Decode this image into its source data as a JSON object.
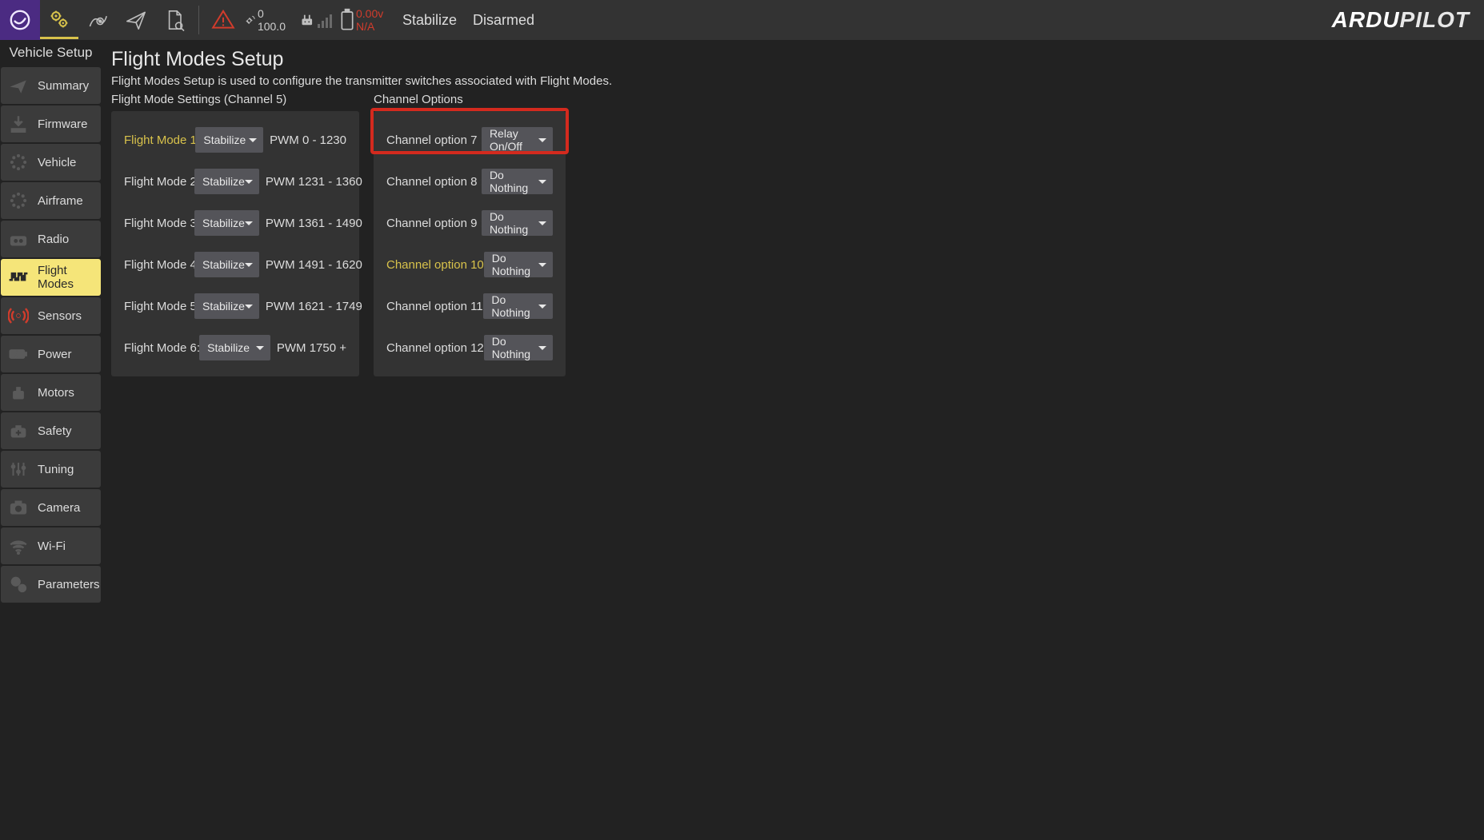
{
  "toolbar": {
    "gps": {
      "top": "0",
      "bottom": "100.0"
    },
    "battery": {
      "volts": "0.00v",
      "na": "N/A"
    },
    "flight_mode": "Stabilize",
    "arm_state": "Disarmed",
    "brand_left": "ARDU",
    "brand_right": "PILOT"
  },
  "sidebar": {
    "title": "Vehicle Setup",
    "items": [
      {
        "label": "Summary"
      },
      {
        "label": "Firmware"
      },
      {
        "label": "Vehicle"
      },
      {
        "label": "Airframe"
      },
      {
        "label": "Radio"
      },
      {
        "label": "Flight Modes"
      },
      {
        "label": "Sensors"
      },
      {
        "label": "Power"
      },
      {
        "label": "Motors"
      },
      {
        "label": "Safety"
      },
      {
        "label": "Tuning"
      },
      {
        "label": "Camera"
      },
      {
        "label": "Wi-Fi"
      },
      {
        "label": "Parameters"
      }
    ]
  },
  "page": {
    "title": "Flight Modes Setup",
    "desc": "Flight Modes Setup is used to configure the transmitter switches associated with Flight Modes.",
    "fm_title": "Flight Mode Settings (Channel 5)",
    "co_title": "Channel Options"
  },
  "flight_modes": [
    {
      "label": "Flight Mode 1:",
      "value": "Stabilize",
      "pwm": "PWM 0 - 1230",
      "hl": true
    },
    {
      "label": "Flight Mode 2:",
      "value": "Stabilize",
      "pwm": "PWM 1231 - 1360",
      "hl": false
    },
    {
      "label": "Flight Mode 3:",
      "value": "Stabilize",
      "pwm": "PWM 1361 - 1490",
      "hl": false
    },
    {
      "label": "Flight Mode 4:",
      "value": "Stabilize",
      "pwm": "PWM 1491 - 1620",
      "hl": false
    },
    {
      "label": "Flight Mode 5:",
      "value": "Stabilize",
      "pwm": "PWM 1621 - 1749",
      "hl": false
    },
    {
      "label": "Flight Mode 6:",
      "value": "Stabilize",
      "pwm": "PWM 1750 +",
      "hl": false
    }
  ],
  "channel_options": [
    {
      "label": "Channel option 7 :",
      "value": "Relay On/Off",
      "hl": false
    },
    {
      "label": "Channel option 8 :",
      "value": "Do Nothing",
      "hl": false
    },
    {
      "label": "Channel option 9 :",
      "value": "Do Nothing",
      "hl": false
    },
    {
      "label": "Channel option 10 :",
      "value": "Do Nothing",
      "hl": true
    },
    {
      "label": "Channel option 11 :",
      "value": "Do Nothing",
      "hl": false
    },
    {
      "label": "Channel option 12 :",
      "value": "Do Nothing",
      "hl": false
    }
  ]
}
